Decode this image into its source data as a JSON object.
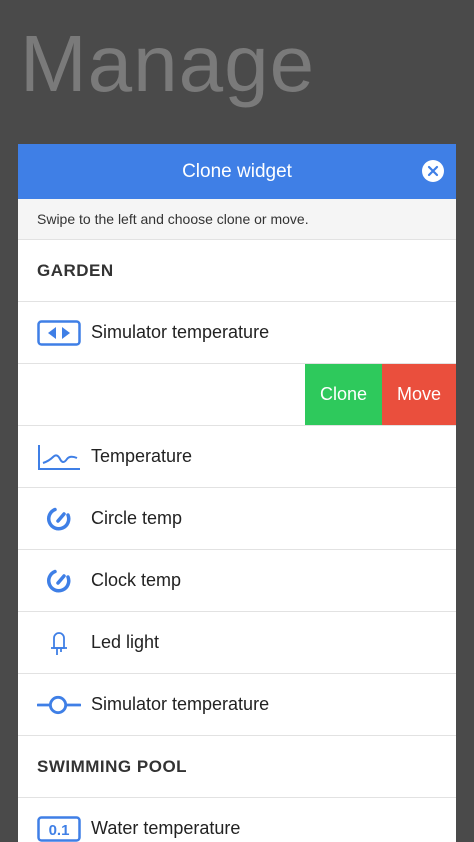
{
  "background": {
    "title": "Manage"
  },
  "modal": {
    "title": "Clone widget",
    "instruction": "Swipe to the left and choose clone or move.",
    "accent": "#3f7fe6"
  },
  "sections": [
    {
      "name": "GARDEN",
      "items": [
        {
          "label": "Simulator temperature",
          "icon": "simulator-arrows-icon"
        },
        {
          "label": "",
          "swiped": true,
          "actions": {
            "clone": "Clone",
            "move": "Move"
          }
        },
        {
          "label": "Temperature",
          "icon": "graph-icon"
        },
        {
          "label": "Circle temp",
          "icon": "gauge-icon"
        },
        {
          "label": "Clock temp",
          "icon": "gauge-icon"
        },
        {
          "label": "Led light",
          "icon": "bulb-icon"
        },
        {
          "label": "Simulator temperature",
          "icon": "slider-icon"
        }
      ]
    },
    {
      "name": "SWIMMING POOL",
      "items": [
        {
          "label": "Water temperature",
          "icon": "value-display-icon",
          "icon_text": "0.1"
        }
      ]
    }
  ],
  "colors": {
    "clone": "#2ec95c",
    "move": "#ea4f3d"
  }
}
